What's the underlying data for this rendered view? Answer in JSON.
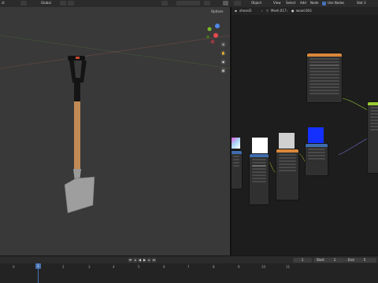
{
  "topbar": {
    "left_label": "ct",
    "orientation": "Global",
    "viewport_shading_label": "Options",
    "node_object_label": "Object",
    "menu_view": "View",
    "menu_select": "Select",
    "menu_add": "Add",
    "menu_node": "Node",
    "use_nodes": "Use Nodes",
    "slot": "Slot 3"
  },
  "breadcrumbs": {
    "object": "shovel2",
    "mesh": "Mesh.017",
    "material": "wood.003"
  },
  "viewport": {
    "options_label": "Options"
  },
  "timeline": {
    "frames": [
      "0",
      "2",
      "3",
      "4",
      "5",
      "6",
      "7",
      "8",
      "9",
      "10",
      "11"
    ],
    "current_frame": "1",
    "current_frame_box": "1",
    "start_label": "Start",
    "start_value": "1",
    "end_label": "End",
    "end_value": "5"
  },
  "colors": {
    "accent_blue": "#4772b3",
    "wood": "#c08a55",
    "normal_map": "#1430ff",
    "node_header_orange": "#d9873a",
    "node_header_blue": "#3e6cae"
  }
}
